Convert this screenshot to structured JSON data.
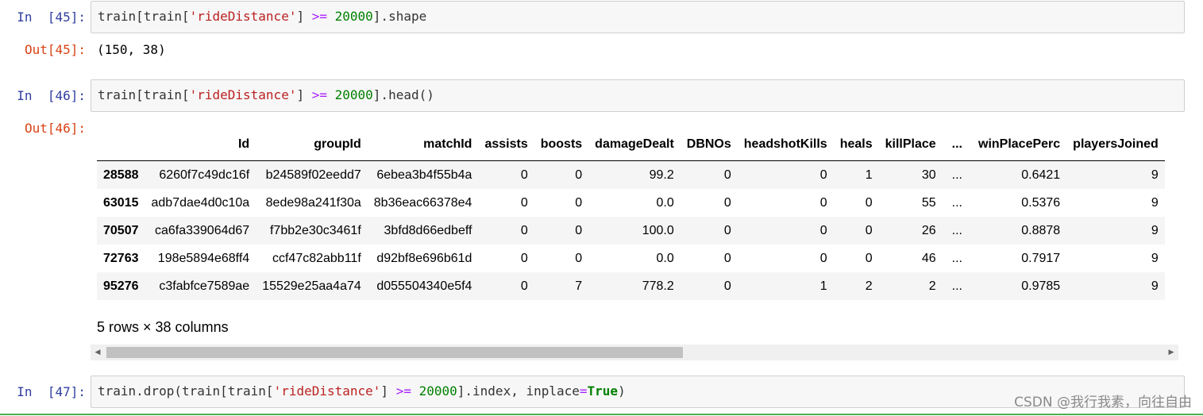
{
  "cells": [
    {
      "in_prompt": "In  [45]:",
      "code": {
        "p1": "train[train[",
        "str": "'rideDistance'",
        "p2": "] ",
        "op": ">=",
        "sp": " ",
        "num": "20000",
        "p3": "].shape"
      },
      "out_prompt": "Out[45]:",
      "output": "(150, 38)"
    },
    {
      "in_prompt": "In  [46]:",
      "code": {
        "p1": "train[train[",
        "str": "'rideDistance'",
        "p2": "] ",
        "op": ">=",
        "sp": " ",
        "num": "20000",
        "p3": "].head()"
      },
      "out_prompt": "Out[46]:"
    },
    {
      "in_prompt": "In  [47]:",
      "code": {
        "p1": "train.drop(train[train[",
        "str": "'rideDistance'",
        "p2": "] ",
        "op": ">=",
        "sp": " ",
        "num": "20000",
        "p3": "].index, inplace",
        "eq": "=",
        "kw": "True",
        "p4": ")"
      }
    }
  ],
  "dataframe": {
    "columns": [
      "",
      "Id",
      "groupId",
      "matchId",
      "assists",
      "boosts",
      "damageDealt",
      "DBNOs",
      "headshotKills",
      "heals",
      "killPlace",
      "...",
      "winPlacePerc",
      "playersJoined"
    ],
    "rows": [
      [
        "28588",
        "6260f7c49dc16f",
        "b24589f02eedd7",
        "6ebea3b4f55b4a",
        "0",
        "0",
        "99.2",
        "0",
        "0",
        "1",
        "30",
        "...",
        "0.6421",
        "9"
      ],
      [
        "63015",
        "adb7dae4d0c10a",
        "8ede98a241f30a",
        "8b36eac66378e4",
        "0",
        "0",
        "0.0",
        "0",
        "0",
        "0",
        "55",
        "...",
        "0.5376",
        "9"
      ],
      [
        "70507",
        "ca6fa339064d67",
        "f7bb2e30c3461f",
        "3bfd8d66edbeff",
        "0",
        "0",
        "100.0",
        "0",
        "0",
        "0",
        "26",
        "...",
        "0.8878",
        "9"
      ],
      [
        "72763",
        "198e5894e68ff4",
        "ccf47c82abb11f",
        "d92bf8e696b61d",
        "0",
        "0",
        "0.0",
        "0",
        "0",
        "0",
        "46",
        "...",
        "0.7917",
        "9"
      ],
      [
        "95276",
        "c3fabfce7589ae",
        "15529e25aa4a74",
        "d055504340e5f4",
        "0",
        "7",
        "778.2",
        "0",
        "1",
        "2",
        "2",
        "...",
        "0.9785",
        "9"
      ]
    ],
    "shape_text": "5 rows × 38 columns"
  },
  "watermark": "CSDN @我行我素，向往自由",
  "colors": {
    "in_prompt": "#303f9f",
    "out_prompt": "#d84315",
    "string": "#ba2121",
    "operator": "#aa22ff",
    "number": "#008000"
  }
}
